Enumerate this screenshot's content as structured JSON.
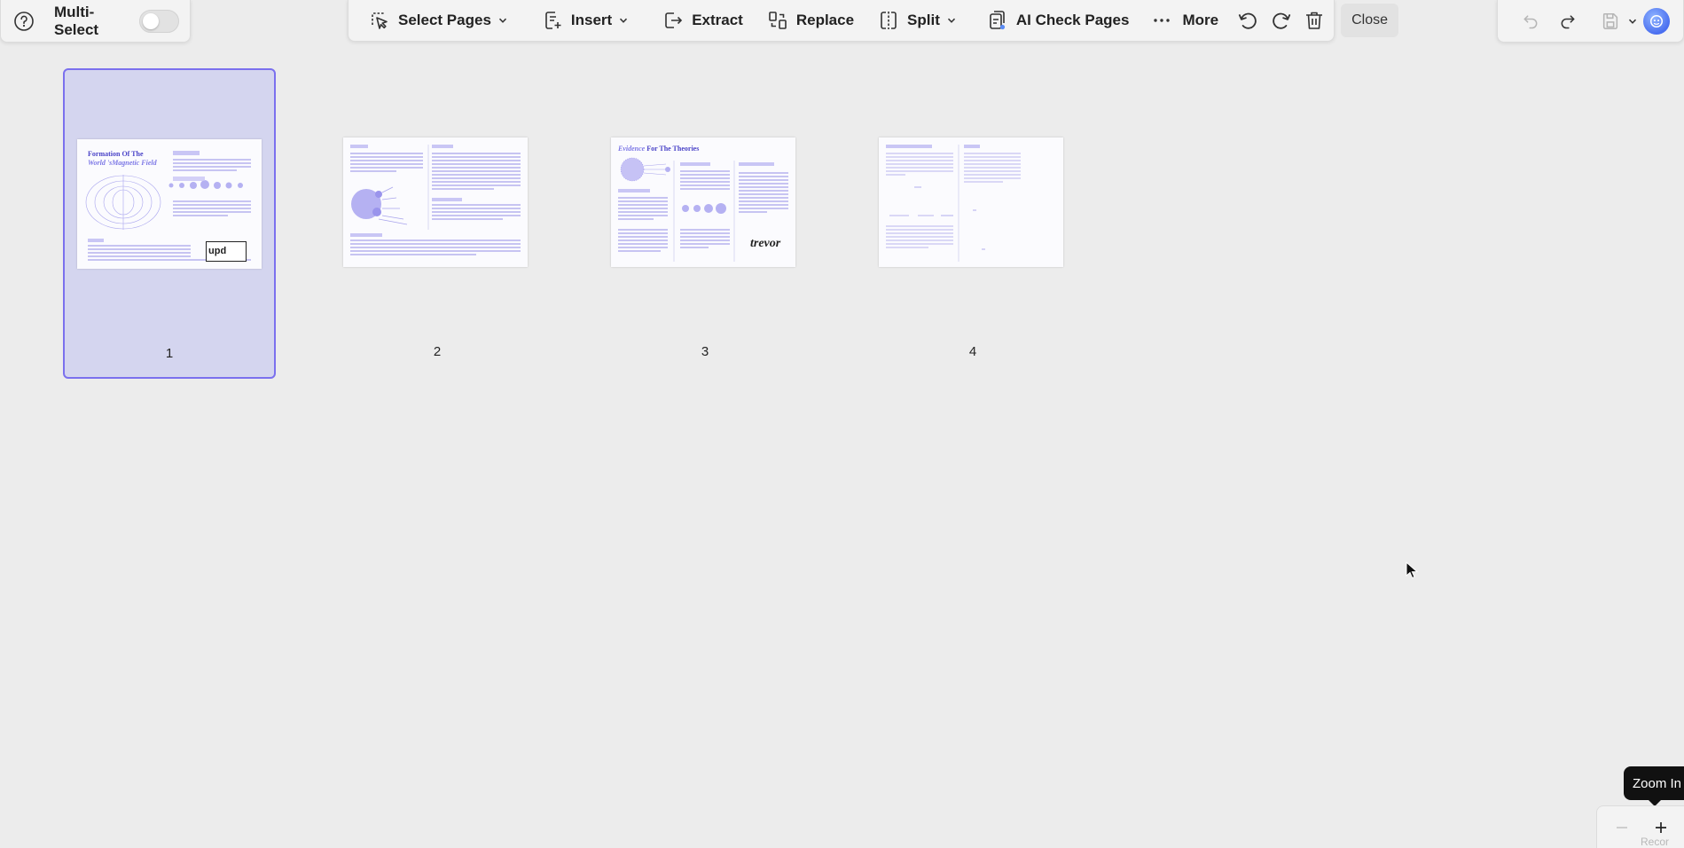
{
  "left_panel": {
    "help_icon": "question-circle",
    "multi_select_label": "Multi-Select",
    "multi_select_on": false
  },
  "toolbar": {
    "select_pages": "Select Pages",
    "insert": "Insert",
    "extract": "Extract",
    "replace": "Replace",
    "split": "Split",
    "ai_check_pages": "AI Check Pages",
    "more": "More",
    "close": "Close"
  },
  "pages": [
    {
      "number": "1",
      "selected": true
    },
    {
      "number": "2",
      "selected": false
    },
    {
      "number": "3",
      "selected": false
    },
    {
      "number": "4",
      "selected": false
    }
  ],
  "thumbnails": {
    "page1_title_line1": "Formation Of The",
    "page1_title_line2": "World 'sMagnetic Field",
    "page1_logo": "upd",
    "page3_title_italic": "Evidence",
    "page3_title_rest": " For The Theories",
    "page3_signature": "trevor"
  },
  "zoom": {
    "tooltip": "Zoom In",
    "below_text": "Recor"
  },
  "colors": {
    "accent": "#7b70ee",
    "selected_bg": "#d4d5ef",
    "thumb_text": "#8f8ae8"
  }
}
